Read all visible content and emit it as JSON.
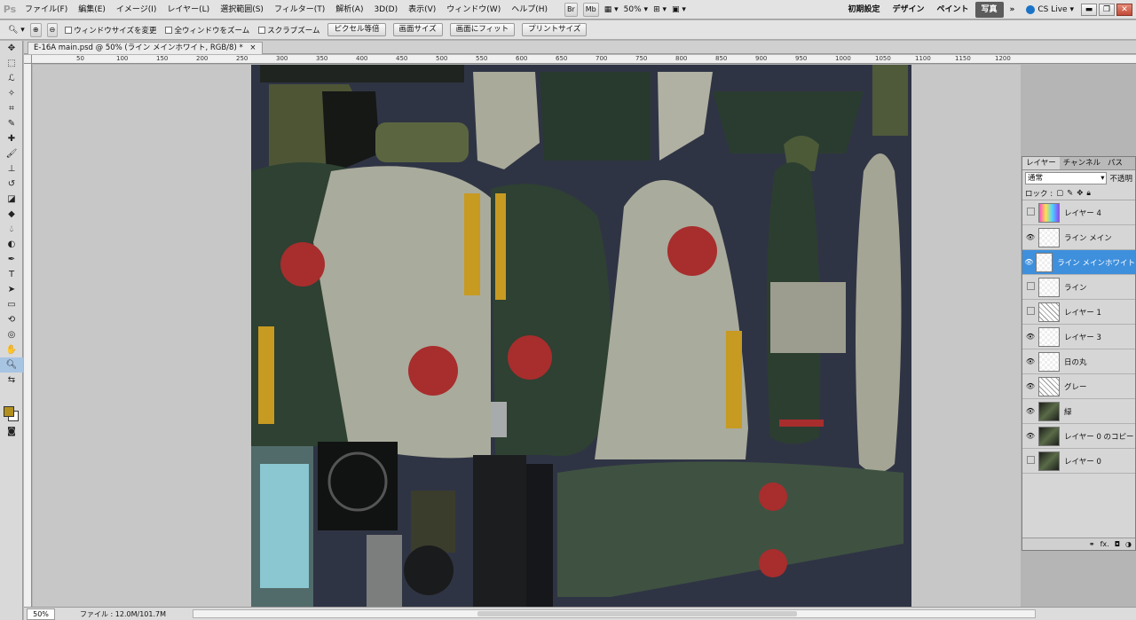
{
  "app": {
    "logo": "Ps"
  },
  "menu": [
    "ファイル(F)",
    "編集(E)",
    "イメージ(I)",
    "レイヤー(L)",
    "選択範囲(S)",
    "フィルター(T)",
    "解析(A)",
    "3D(D)",
    "表示(V)",
    "ウィンドウ(W)",
    "ヘルプ(H)"
  ],
  "app_bar": {
    "br": "Br",
    "mb": "Mb",
    "zoom": "50%"
  },
  "workspaces": [
    "初期設定",
    "デザイン",
    "ペイント",
    "写真"
  ],
  "cs_live": "CS Live",
  "window_controls": {
    "min": "▬",
    "restore": "❐",
    "close": "✕"
  },
  "options": {
    "checkboxes": [
      "ウィンドウサイズを変更",
      "全ウィンドウをズーム",
      "スクラブズーム"
    ],
    "buttons": [
      "ピクセル等倍",
      "画面サイズ",
      "画面にフィット",
      "プリントサイズ"
    ]
  },
  "document": {
    "tab_title": "E-16A main.psd @ 50% (ライン メインホワイト, RGB/8) *",
    "close": "×"
  },
  "ruler": {
    "h": [
      "50",
      "100",
      "150",
      "200",
      "250",
      "300",
      "350",
      "400",
      "450",
      "500",
      "550",
      "600",
      "650",
      "700",
      "750",
      "800",
      "850",
      "900",
      "950",
      "1000",
      "1050",
      "1100",
      "1150",
      "1200"
    ]
  },
  "status": {
    "zoom": "50%",
    "file": "ファイル : 12.0M/101.7M"
  },
  "layers_panel": {
    "tabs": [
      "レイヤー",
      "チャンネル",
      "パス"
    ],
    "blend_mode": "通常",
    "opacity_label": "不透明",
    "lock_label": "ロック :",
    "layers": [
      {
        "name": "レイヤー 4",
        "visible": false,
        "selected": false,
        "thumb": "gradient"
      },
      {
        "name": "ライン メイン",
        "visible": true,
        "selected": false,
        "thumb": "blank"
      },
      {
        "name": "ライン メインホワイト",
        "visible": true,
        "selected": true,
        "thumb": "blank"
      },
      {
        "name": "ライン",
        "visible": false,
        "selected": false,
        "thumb": "blank"
      },
      {
        "name": "レイヤー 1",
        "visible": false,
        "selected": false,
        "thumb": "lines"
      },
      {
        "name": "レイヤー 3",
        "visible": true,
        "selected": false,
        "thumb": "blank"
      },
      {
        "name": "日の丸",
        "visible": true,
        "selected": false,
        "thumb": "blank"
      },
      {
        "name": "グレー",
        "visible": true,
        "selected": false,
        "thumb": "lines"
      },
      {
        "name": "緑",
        "visible": true,
        "selected": false,
        "thumb": "dark"
      },
      {
        "name": "レイヤー 0 のコピー",
        "visible": true,
        "selected": false,
        "thumb": "dark"
      },
      {
        "name": "レイヤー 0",
        "visible": false,
        "selected": false,
        "thumb": "dark"
      }
    ],
    "footer_icons": [
      "link-icon",
      "fx-icon",
      "mask-icon",
      "adjustment-icon"
    ],
    "fx_label": "fx."
  },
  "colors": {
    "foreground": "#b3901e",
    "background": "#ffffff",
    "accent": "#3e8fdc",
    "texture_bg": "#2f3444"
  }
}
